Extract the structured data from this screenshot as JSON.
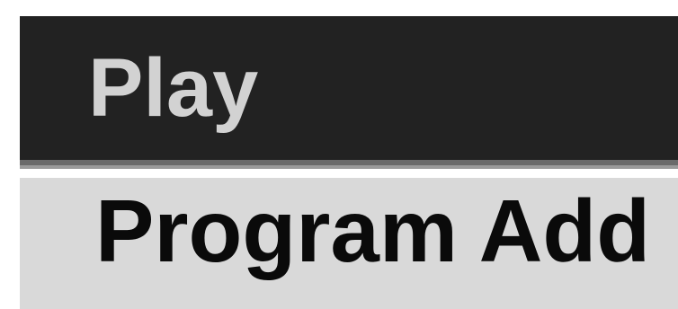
{
  "menu": {
    "items": [
      {
        "label": "Play",
        "selected": true
      },
      {
        "label": "Program Add",
        "selected": false
      }
    ]
  },
  "colors": {
    "selected_background": "#222222",
    "selected_text": "#d2d2d2",
    "item_background": "#d9d9d9",
    "item_text": "#0a0a0a"
  }
}
